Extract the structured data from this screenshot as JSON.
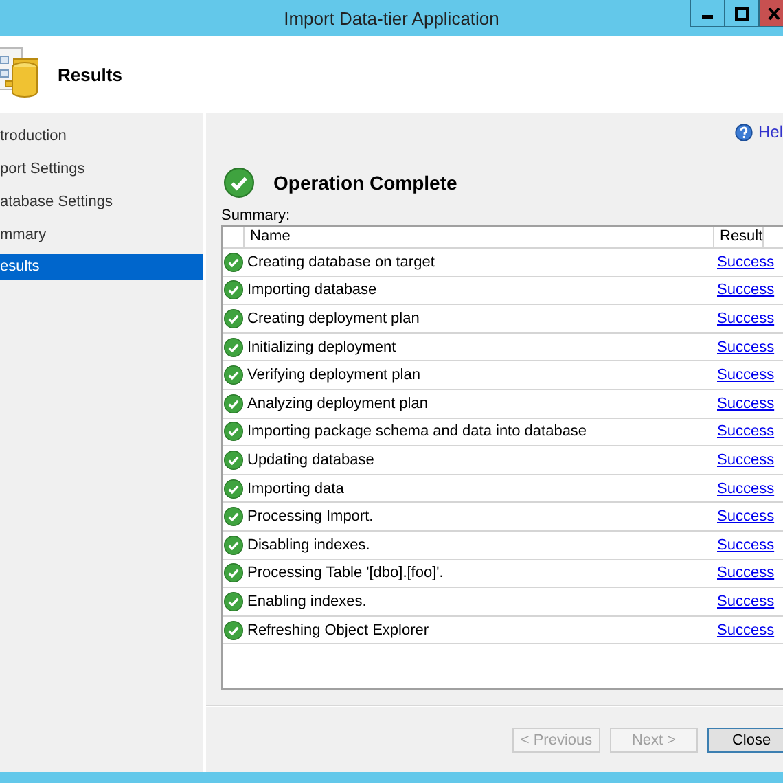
{
  "window": {
    "title": "Import Data-tier Application"
  },
  "header": {
    "title": "Results"
  },
  "sidebar": {
    "items": [
      {
        "label": "troduction",
        "selected": false
      },
      {
        "label": "port Settings",
        "selected": false
      },
      {
        "label": "atabase Settings",
        "selected": false
      },
      {
        "label": "mmary",
        "selected": false
      },
      {
        "label": "esults",
        "selected": true
      }
    ]
  },
  "help_link": "Hel",
  "status": {
    "title": "Operation Complete"
  },
  "summary_label": "Summary:",
  "table": {
    "columns": [
      "Name",
      "Result"
    ],
    "rows": [
      {
        "name": "Creating database on target",
        "result": "Success"
      },
      {
        "name": "Importing database",
        "result": "Success"
      },
      {
        "name": "Creating deployment plan",
        "result": "Success"
      },
      {
        "name": "Initializing deployment",
        "result": "Success"
      },
      {
        "name": "Verifying deployment plan",
        "result": "Success"
      },
      {
        "name": "Analyzing deployment plan",
        "result": "Success"
      },
      {
        "name": "Importing package schema and data into database",
        "result": "Success"
      },
      {
        "name": "Updating database",
        "result": "Success"
      },
      {
        "name": "Importing data",
        "result": "Success"
      },
      {
        "name": "Processing Import.",
        "result": "Success"
      },
      {
        "name": "Disabling indexes.",
        "result": "Success"
      },
      {
        "name": "Processing Table '[dbo].[foo]'.",
        "result": "Success"
      },
      {
        "name": "Enabling indexes.",
        "result": "Success"
      },
      {
        "name": "Refreshing Object Explorer",
        "result": "Success"
      }
    ]
  },
  "buttons": [
    {
      "label": "< Previous",
      "disabled": true
    },
    {
      "label": "Next >",
      "disabled": true
    },
    {
      "label": "Close",
      "disabled": false
    }
  ]
}
